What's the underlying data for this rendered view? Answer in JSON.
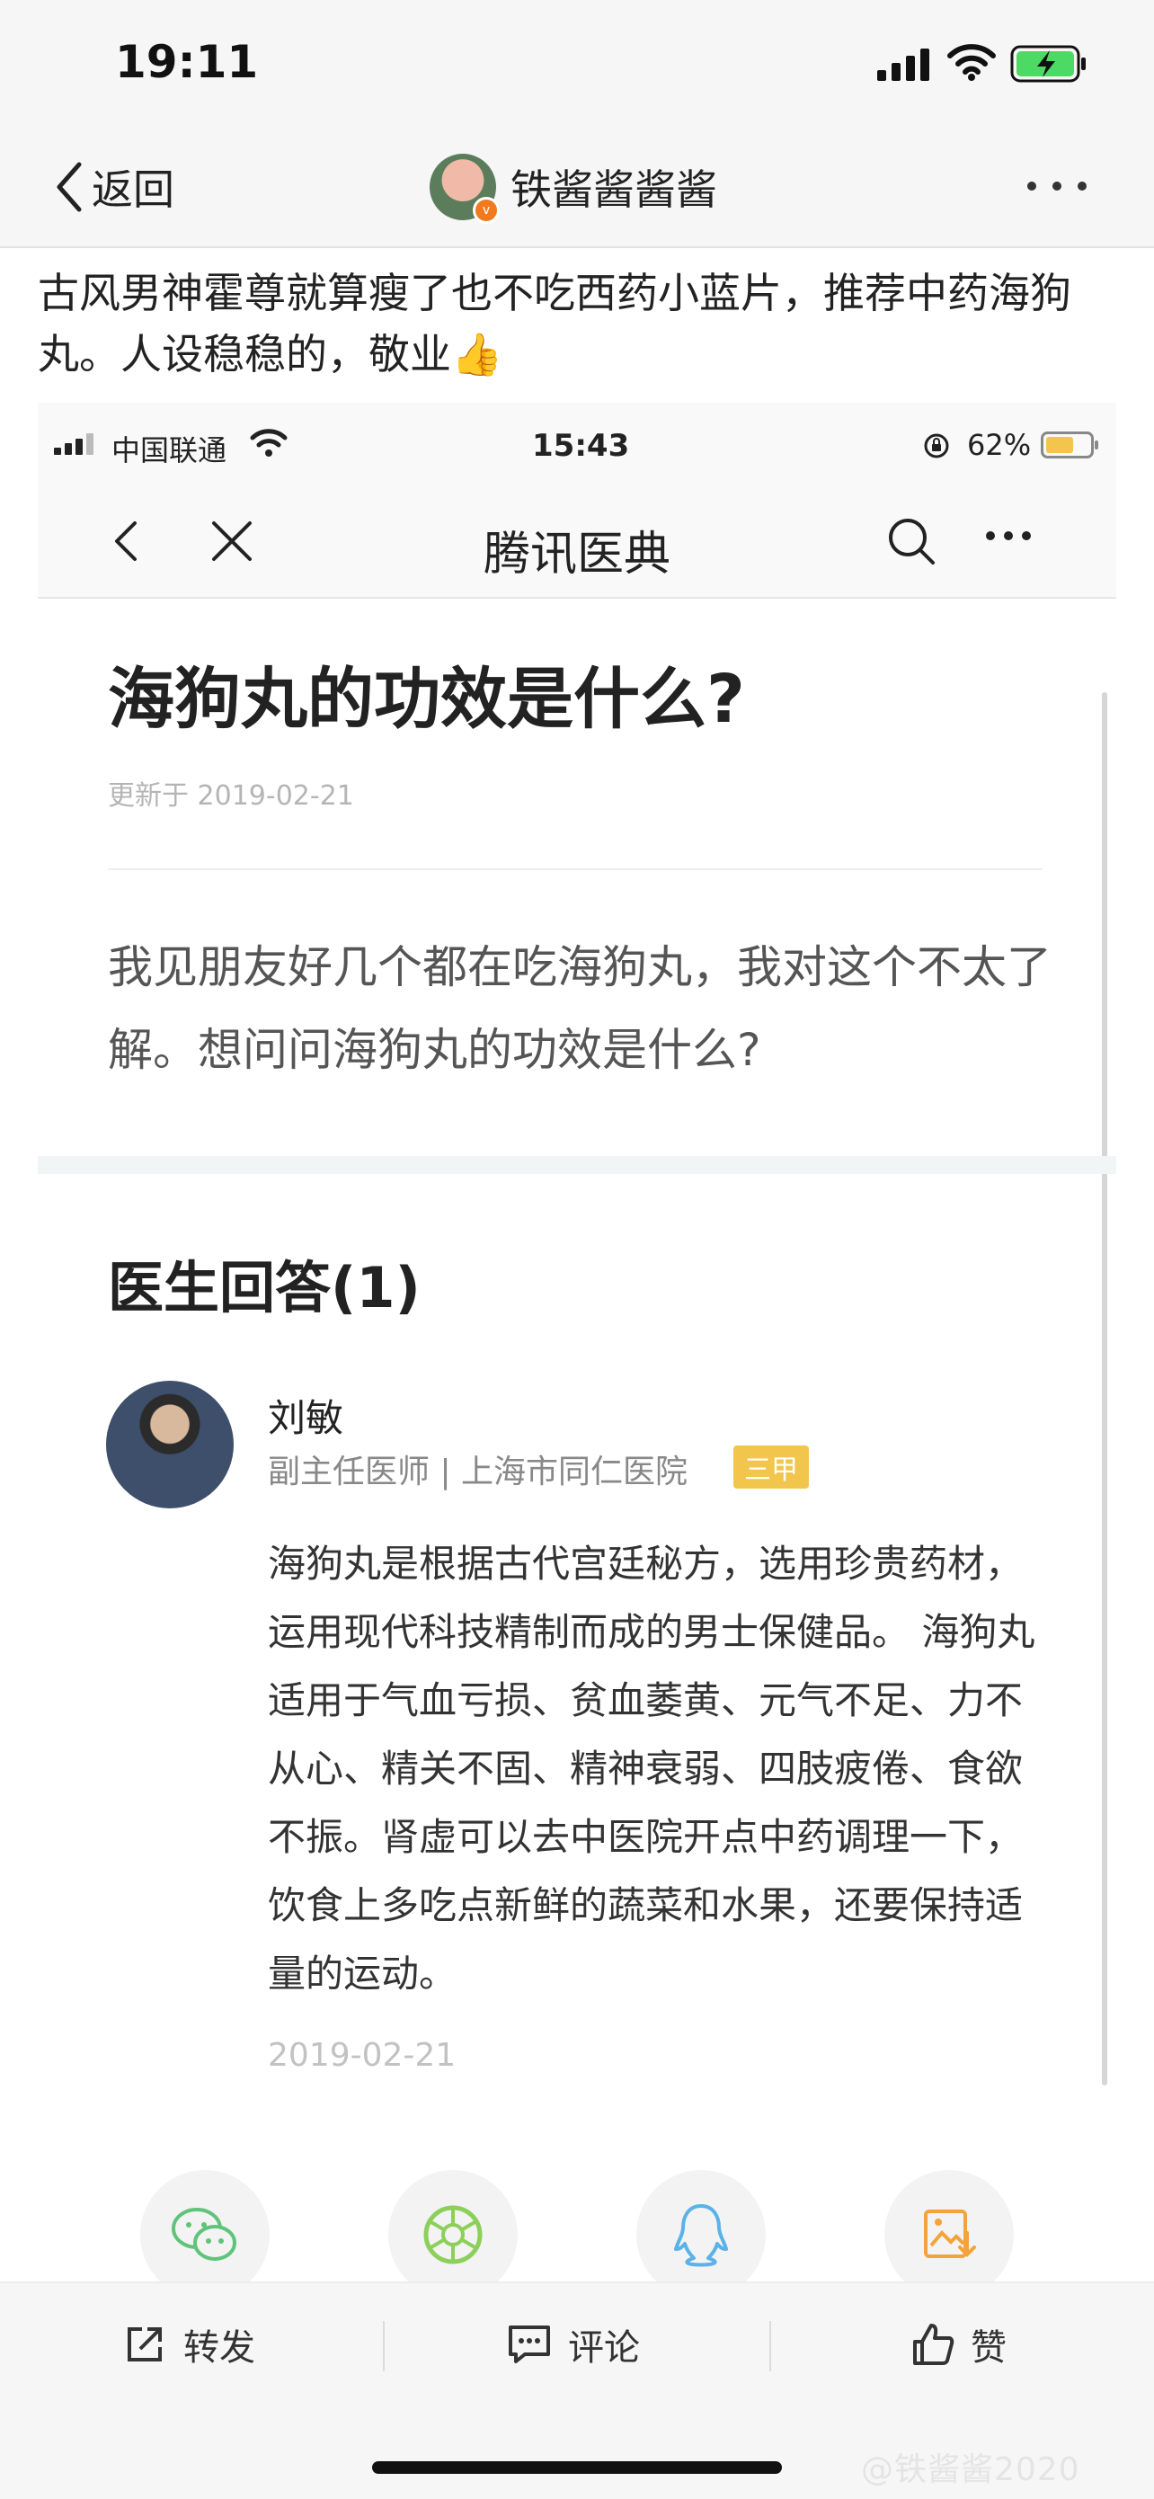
{
  "status_bar": {
    "time": "19:11"
  },
  "nav": {
    "back_label": "返回",
    "profile_name": "铁酱酱酱酱",
    "more_icon": "ellipsis-icon"
  },
  "post": {
    "text": "古风男神霍尊就算瘦了也不吃西药小蓝片，推荐中药海狗丸。人设稳稳的，敬业👍"
  },
  "screenshot": {
    "status": {
      "carrier": "中国联通",
      "time": "15:43",
      "battery": "62%"
    },
    "nav": {
      "title": "腾讯医典"
    },
    "article": {
      "title": "海狗丸的功效是什么?",
      "updated": "更新于 2019-02-21",
      "question": "我见朋友好几个都在吃海狗丸，我对这个不太了解。想问问海狗丸的功效是什么?"
    },
    "answers": {
      "heading": "医生回答",
      "count": "(1)",
      "doctor": {
        "name": "刘敏",
        "title": "副主任医师 | 上海市同仁医院",
        "badge": "三甲"
      },
      "body": "海狗丸是根据古代宫廷秘方，选用珍贵药材，运用现代科技精制而成的男士保健品。 海狗丸适用于气血亏损、贫血萎黄、元气不足、力不从心、精关不固、精神衰弱、四肢疲倦、食欲不振。肾虚可以去中医院开点中药调理一下，饮食上多吃点新鲜的蔬菜和水果，还要保持适量的运动。",
      "date": "2019-02-21"
    },
    "share_icons": [
      "wechat-icon",
      "moments-icon",
      "qq-icon",
      "save-image-icon"
    ],
    "colors": {
      "badge": "#f2c54d",
      "wechat": "#5fc47a",
      "moments": "#8ccf5a",
      "qq": "#5ab2e8",
      "save": "#f3a33a"
    }
  },
  "actions": {
    "repost": "转发",
    "comment": "评论",
    "like": "赞"
  },
  "watermark": "@铁酱酱2020"
}
